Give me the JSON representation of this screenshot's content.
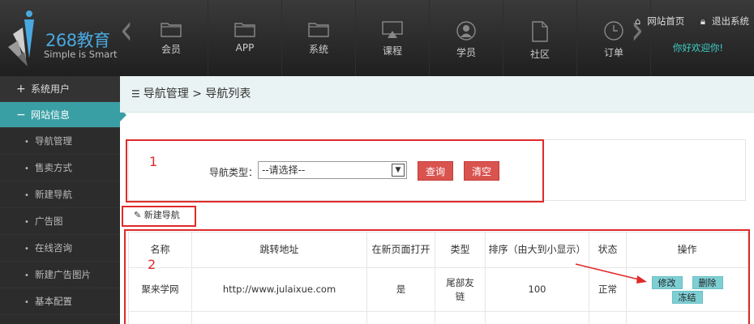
{
  "brand": {
    "title": "268教育",
    "subtitle": "Simple is Smart",
    "accent": "#4aa8e0"
  },
  "nav": [
    {
      "label": "会员",
      "icon": "folder-icon"
    },
    {
      "label": "APP",
      "icon": "folder-icon"
    },
    {
      "label": "系统",
      "icon": "folder-icon"
    },
    {
      "label": "课程",
      "icon": "monitor-icon"
    },
    {
      "label": "学员",
      "icon": "user-icon"
    },
    {
      "label": "社区",
      "icon": "document-icon"
    },
    {
      "label": "订单",
      "icon": "clock-icon"
    }
  ],
  "top_links": {
    "home": "网站首页",
    "logout": "退出系统",
    "welcome": "你好欢迎你!"
  },
  "sidebar": {
    "group1": {
      "label": "系统用户",
      "symbol": "+"
    },
    "group2": {
      "label": "网站信息",
      "symbol": "−"
    },
    "items": [
      "导航管理",
      "售卖方式",
      "新建导航",
      "广告图",
      "在线咨询",
      "新建广告图片",
      "基本配置"
    ]
  },
  "breadcrumb": {
    "text": "导航管理 > 导航列表"
  },
  "search": {
    "label": "导航类型：",
    "select_value": "--请选择--",
    "query_button": "查询",
    "clear_button": "清空"
  },
  "annotations": {
    "box1": "1",
    "box2": "2"
  },
  "new_button": "新建导航",
  "table": {
    "headers": [
      "名称",
      "跳转地址",
      "在新页面打开",
      "类型",
      "排序（由大到小显示）",
      "状态",
      "操作"
    ],
    "rows": [
      {
        "name": "聚来学网",
        "url": "http://www.julaixue.com",
        "new_page": "是",
        "type": "尾部友链",
        "order": "100",
        "status": "正常",
        "actions": [
          "修改",
          "删除",
          "冻结"
        ]
      }
    ]
  },
  "colors": {
    "sidebar_active": "#3a9fa5",
    "danger": "#d9534f",
    "annotation": "#e02a2a",
    "action": "#7ecfd4"
  }
}
